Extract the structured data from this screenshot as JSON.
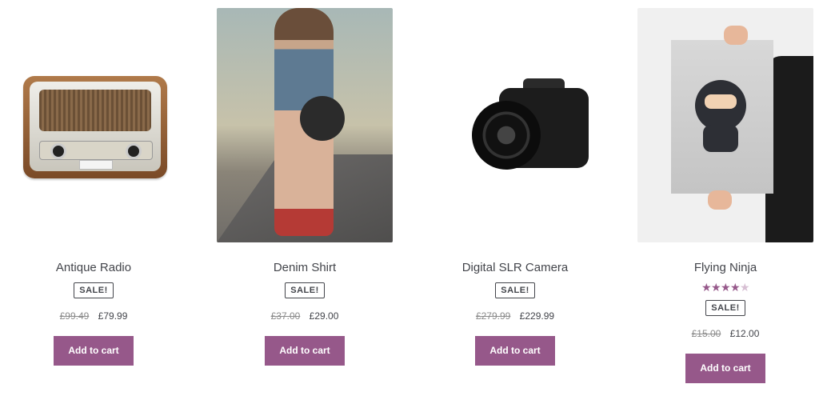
{
  "products": [
    {
      "title": "Antique Radio",
      "badge": "SALE!",
      "price_old": "£99.49",
      "price_new": "£79.99",
      "button_label": "Add to cart",
      "image": "antique-radio-image"
    },
    {
      "title": "Denim Shirt",
      "badge": "SALE!",
      "price_old": "£37.00",
      "price_new": "£29.00",
      "button_label": "Add to cart",
      "image": "denim-shirt-image"
    },
    {
      "title": "Digital SLR Camera",
      "badge": "SALE!",
      "price_old": "£279.99",
      "price_new": "£229.99",
      "button_label": "Add to cart",
      "image": "digital-slr-camera-image"
    },
    {
      "title": "Flying Ninja",
      "rating": 4,
      "rating_max": 5,
      "badge": "SALE!",
      "price_old": "£15.00",
      "price_new": "£12.00",
      "button_label": "Add to cart",
      "image": "flying-ninja-image"
    }
  ],
  "colors": {
    "button_bg": "#96588a",
    "star_filled": "#96588a",
    "star_empty": "#d7bfd3",
    "text": "#43454b"
  }
}
